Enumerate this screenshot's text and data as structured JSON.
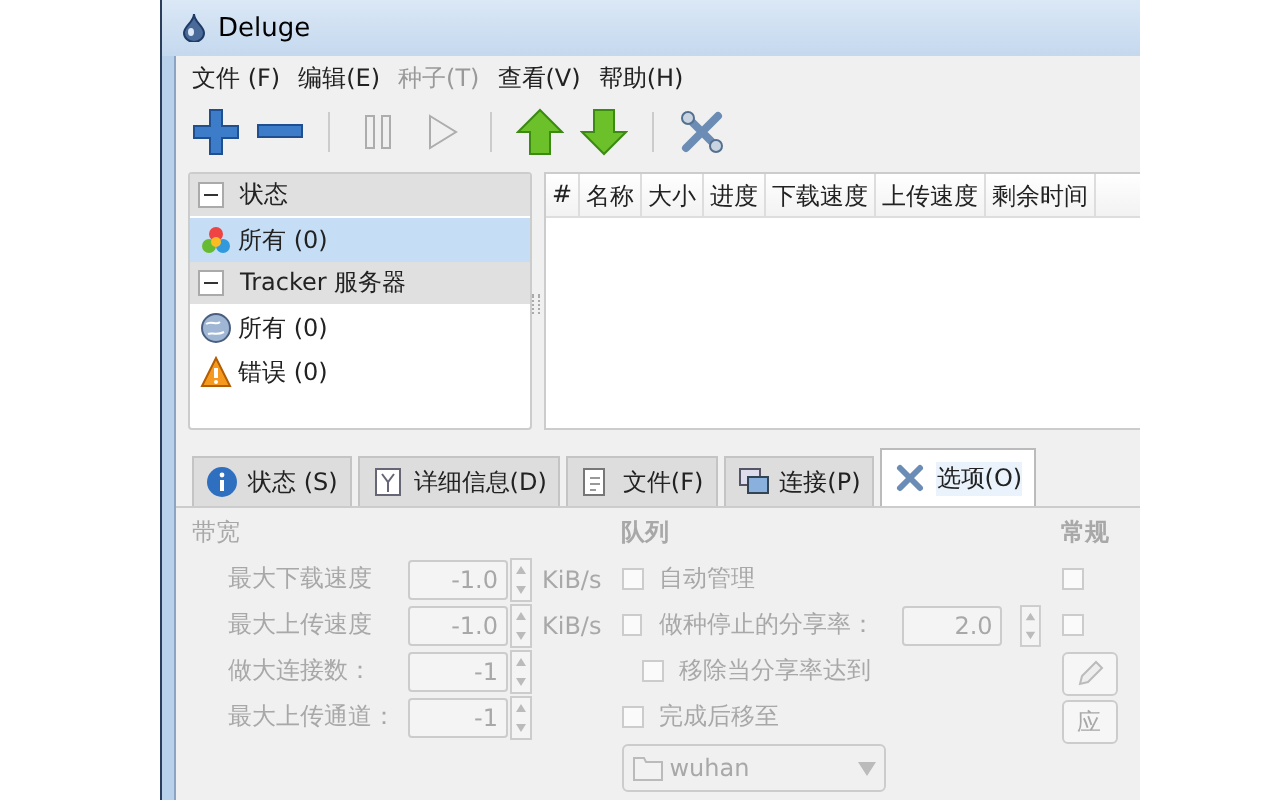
{
  "window": {
    "title": "Deluge"
  },
  "menu": [
    {
      "label": "文件 (F)",
      "disabled": false
    },
    {
      "label": "编辑(E)",
      "disabled": false
    },
    {
      "label": "种子(T)",
      "disabled": true
    },
    {
      "label": "查看(V)",
      "disabled": false
    },
    {
      "label": "帮助(H)",
      "disabled": false
    }
  ],
  "toolbar": [
    {
      "kind": "add",
      "disabled": false
    },
    {
      "kind": "remove",
      "disabled": false
    },
    {
      "kind": "separator"
    },
    {
      "kind": "pause",
      "disabled": true
    },
    {
      "kind": "resume",
      "disabled": true
    },
    {
      "kind": "separator"
    },
    {
      "kind": "up",
      "disabled": false
    },
    {
      "kind": "down",
      "disabled": false
    },
    {
      "kind": "separator"
    },
    {
      "kind": "preferences",
      "disabled": false
    }
  ],
  "sidebar": {
    "groups": [
      {
        "label": "状态",
        "expanded": true,
        "children": [
          {
            "label": "所有 (0)",
            "kind": "all",
            "selected": true
          }
        ]
      },
      {
        "label": "Tracker 服务器",
        "expanded": true,
        "children": [
          {
            "label": "所有 (0)",
            "kind": "globe",
            "selected": false
          },
          {
            "label": "错误 (0)",
            "kind": "warning",
            "selected": false
          }
        ]
      }
    ]
  },
  "table": {
    "columns": [
      "#",
      "名称",
      "大小",
      "进度",
      "下载速度",
      "上传速度",
      "剩余时间"
    ]
  },
  "tabs": [
    {
      "label": "状态 (S)",
      "kind": "info",
      "selected": false
    },
    {
      "label": "详细信息(D)",
      "kind": "details",
      "selected": false
    },
    {
      "label": "文件(F)",
      "kind": "files",
      "selected": false
    },
    {
      "label": "连接(P)",
      "kind": "peers",
      "selected": false
    },
    {
      "label": "选项(O)",
      "kind": "options",
      "selected": true
    }
  ],
  "options": {
    "disabled": true,
    "bandwidth": {
      "title": "带宽",
      "fields": [
        {
          "label": "最大下载速度",
          "value": "-1.0",
          "unit": "KiB/s"
        },
        {
          "label": "最大上传速度",
          "value": "-1.0",
          "unit": "KiB/s"
        },
        {
          "label": "做大连接数：",
          "value": "-1"
        },
        {
          "label": "最大上传通道：",
          "value": "-1"
        }
      ]
    },
    "queue": {
      "title": "队列",
      "auto_managed": {
        "label": "自动管理",
        "checked": false
      },
      "stop_ratio": {
        "label": "做种停止的分享率：",
        "checked": false,
        "value": "2.0"
      },
      "remove_at_ratio": {
        "label": "移除当分享率达到",
        "checked": false
      },
      "move_completed": {
        "label": "完成后移至",
        "checked": false,
        "folder": "wuhan"
      }
    },
    "general": {
      "title": "常规",
      "checkboxes": [
        {
          "checked": false
        },
        {
          "checked": false
        }
      ],
      "apply_button": "应"
    }
  }
}
